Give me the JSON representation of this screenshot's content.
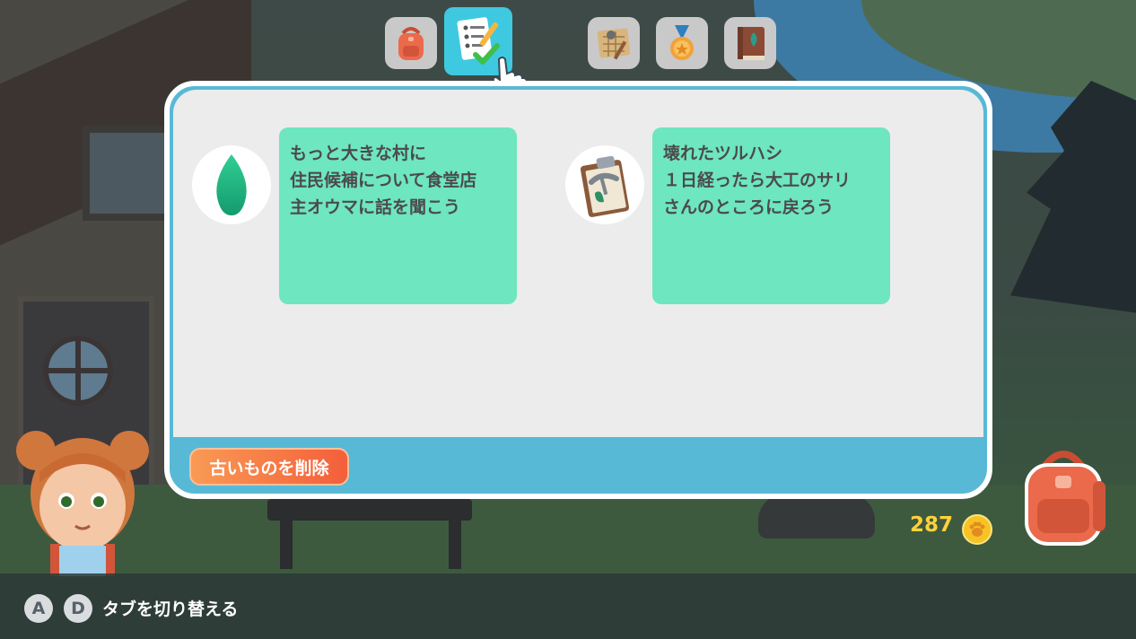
{
  "tabs": [
    {
      "icon": "backpack-tab-icon",
      "active": false
    },
    {
      "icon": "quest-checklist-tab-icon",
      "active": true
    },
    {
      "icon": "map-tab-icon",
      "active": false
    },
    {
      "icon": "medal-tab-icon",
      "active": false
    },
    {
      "icon": "book-tab-icon",
      "active": false
    }
  ],
  "quests": [
    {
      "icon": "leaf-icon",
      "title": "もっと大きな村に",
      "lines": [
        "住民候補について食堂店",
        "主オウマに話を聞こう"
      ]
    },
    {
      "icon": "clipboard-pickaxe-icon",
      "title": "壊れたツルハシ",
      "lines": [
        "１日経ったら大工のサリ",
        "さんのところに戻ろう"
      ]
    }
  ],
  "actions": {
    "delete_old": "古いものを削除"
  },
  "currency": {
    "amount": "287",
    "icon": "paw-coin-icon"
  },
  "hint": {
    "key_a": "A",
    "key_d": "D",
    "text": "タブを切り替える"
  },
  "colors": {
    "panel_border": "#58b9d6",
    "quest_card": "#6ee6bf",
    "active_tab": "#3ec9e1",
    "delete_button": "#f45f3a",
    "coin_text": "#ffd23b"
  }
}
